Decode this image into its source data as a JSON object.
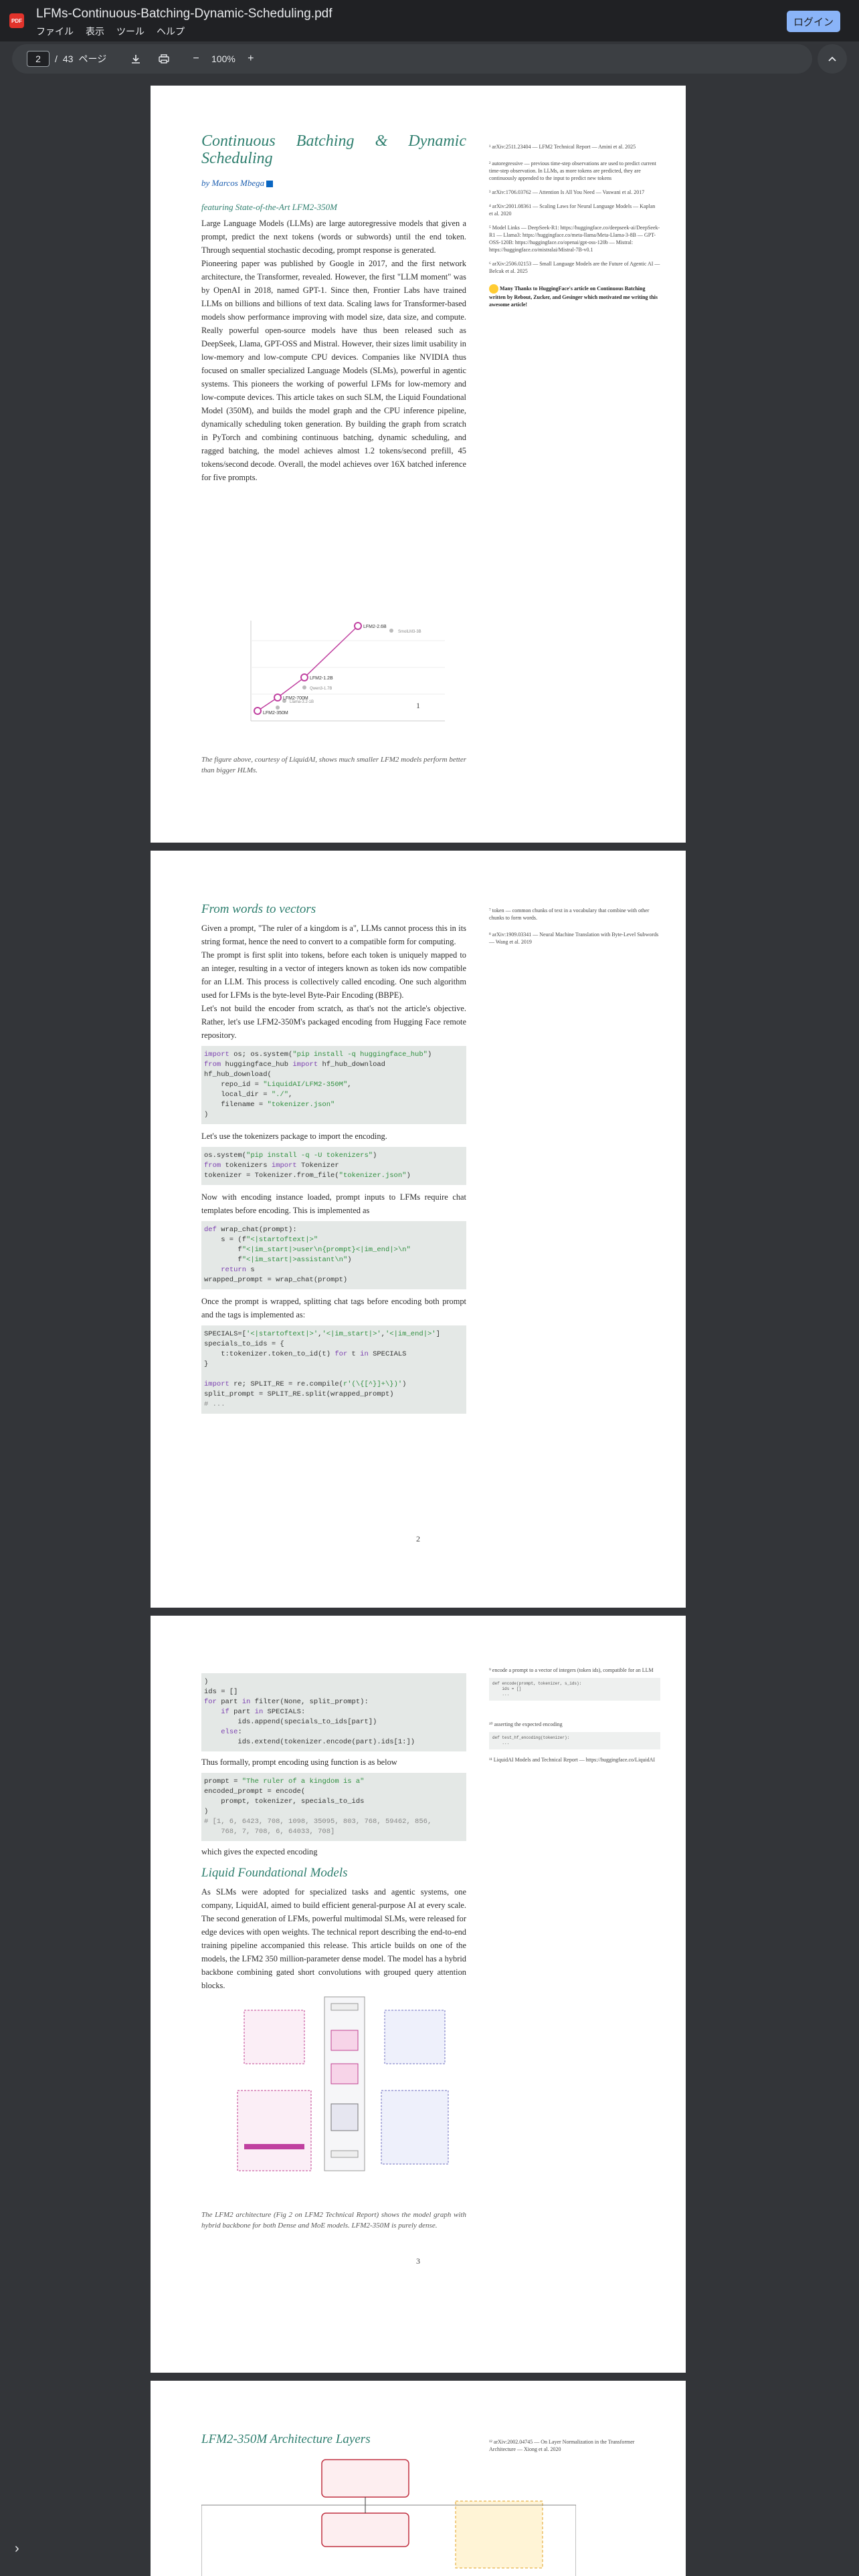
{
  "window": {
    "title": "LFMs-Continuous-Batching-Dynamic-Scheduling.pdf",
    "menu": [
      "ファイル",
      "表示",
      "ツール",
      "ヘルプ"
    ],
    "login_label": "ログイン"
  },
  "toolbar": {
    "current_page": "2",
    "separator": "/",
    "total_pages": "43",
    "pages_suffix": "ページ",
    "zoom": "100%"
  },
  "page1": {
    "title": "Continuous Batching & Dynamic Scheduling",
    "author": "by Marcos Mbega",
    "featuring": "featuring State-of-the-Art LFM2-350M",
    "paragraphs": [
      "Large Language Models (LLMs) are large autoregressive models that given a prompt, predict the next tokens (words or subwords) until the end token. Through sequential stochastic decoding, prompt response is generated.",
      "Pioneering paper was published by Google in 2017, and the first network architecture, the Transformer, revealed. However, the first \"LLM moment\" was by OpenAI in 2018, named GPT-1. Since then, Frontier Labs have trained LLMs on billions and billions of text data. Scaling laws for Transformer-based models show performance improving with model size, data size, and compute. Really powerful open-source models have thus been released such as DeepSeek, Llama, GPT-OSS and Mistral. However, their sizes limit usability in low-memory and low-compute CPU devices. Companies like NVIDIA thus focused on smaller specialized Language Models (SLMs), powerful in agentic systems. This pioneers the working of powerful LFMs for low-memory and low-compute devices. This article takes on such SLM, the Liquid Foundational Model (350M), and builds the model graph and the CPU inference pipeline, dynamically scheduling token generation. By building the graph from scratch in PyTorch and combining continuous batching, dynamic scheduling, and ragged batching, the model achieves almost 1.2 tokens/second prefill, 45 tokens/second decode. Overall, the model achieves over 16X batched inference for five prompts."
    ],
    "figure_caption": "The figure above, courtesy of LiquidAI, shows much smaller LFM2 models perform better than bigger HLMs.",
    "page_number": "1",
    "side_notes": [
      "¹ arXiv:2511.23404 — LFM2 Technical Report — Amini et al. 2025",
      "² autoregressive — previous time-step observations are used to predict current time-step observation. In LLMs, as more tokens are predicted, they are continuously appended to the input to predict new tokens",
      "³ arXiv:1706.03762 — Attention Is All You Need — Vaswani et al. 2017",
      "⁴ arXiv:2001.08361 — Scaling Laws for Neural Language Models — Kaplan et al. 2020",
      "⁵ Model Links — DeepSeek-R1: https://huggingface.co/deepseek-ai/DeepSeek-R1 — Llama3: https://huggingface.co/meta-llama/Meta-Llama-3-8B — GPT-OSS-120B: https://huggingface.co/openai/gpt-oss-120b — Mistral: https://huggingface.co/mistralai/Mistral-7B-v0.1",
      "⁶ arXiv:2506.02153 — Small Language Models are the Future of Agentic AI — Belcak et al. 2025"
    ],
    "thanks": "Many Thanks to HuggingFace's article on Continuous Batching written by Rebout, Zucker, and Gesinger which motivated me writing this awesome article!"
  },
  "page2": {
    "heading": "From words to vectors",
    "p1": "Given a prompt, \"The ruler of a kingdom is a\", LLMs cannot process this in its string format, hence the need to convert to a compatible form for computing.",
    "p2": "The prompt is first split into tokens, before each token is uniquely mapped to an integer, resulting in a vector of integers known as token ids now compatible for an LLM. This process is collectively called encoding. One such algorithm used for LFMs is the byte-level Byte-Pair Encoding (BBPE).",
    "p3": "Let's not build the encoder from scratch, as that's not the article's objective. Rather, let's use LFM2-350M's packaged encoding from Hugging Face remote repository.",
    "p4": "Let's use the tokenizers package to import the encoding.",
    "p5": "Now with encoding instance loaded, prompt inputs to LFMs require chat templates before encoding. This is implemented as",
    "p6": "Once the prompt is wrapped, splitting chat tags before encoding both prompt and the tags is implemented as:",
    "page_number": "2",
    "side_notes": [
      "⁷ token — common chunks of text in a vocabulary that combine with other chunks to form words.",
      "⁸ arXiv:1909.03341 — Neural Machine Translation with Byte-Level Subwords — Wang et al. 2019"
    ]
  },
  "page3": {
    "p1": "Thus formally, prompt encoding using function is as below",
    "p2": "which gives the expected encoding",
    "heading": "Liquid Foundational Models",
    "p3": "As SLMs were adopted for specialized tasks and agentic systems, one company, LiquidAI, aimed to build efficient general-purpose AI at every scale. The second generation of LFMs, powerful multimodal SLMs, were released for edge devices with open weights. The technical report describing the end-to-end training pipeline accompanied this release. This article builds on one of the models, the LFM2 350 million-parameter dense model. The model has a hybrid backbone combining gated short convolutions with grouped query attention blocks.",
    "figure_caption": "The LFM2 architecture (Fig 2 on LFM2 Technical Report) shows the model graph with hybrid backbone for both Dense and MoE models. LFM2-350M is purely dense.",
    "page_number": "3",
    "side_notes": [
      "⁹ encode a prompt to a vector of integers (token ids), compatible for an LLM",
      "¹⁰ asserting the expected encoding",
      "¹¹ LiquidAI Models and Technical Report — https://huggingface.co/LiquidAI"
    ]
  },
  "page4": {
    "heading": "LFM2-350M Architecture Layers",
    "side_note": "¹² arXiv:2002.04745 — On Layer Normalization in the Transformer Architecture — Xiong et al. 2020"
  },
  "chart": {
    "labels": [
      "LFM2-2.6B",
      "LFM2-1.2B",
      "LFM2-700M",
      "LFM2-350M",
      "Qwen3-1.7B",
      "Llama-3.2-1B",
      "Gemma-3-1B",
      "SmolLM3-3B"
    ]
  }
}
